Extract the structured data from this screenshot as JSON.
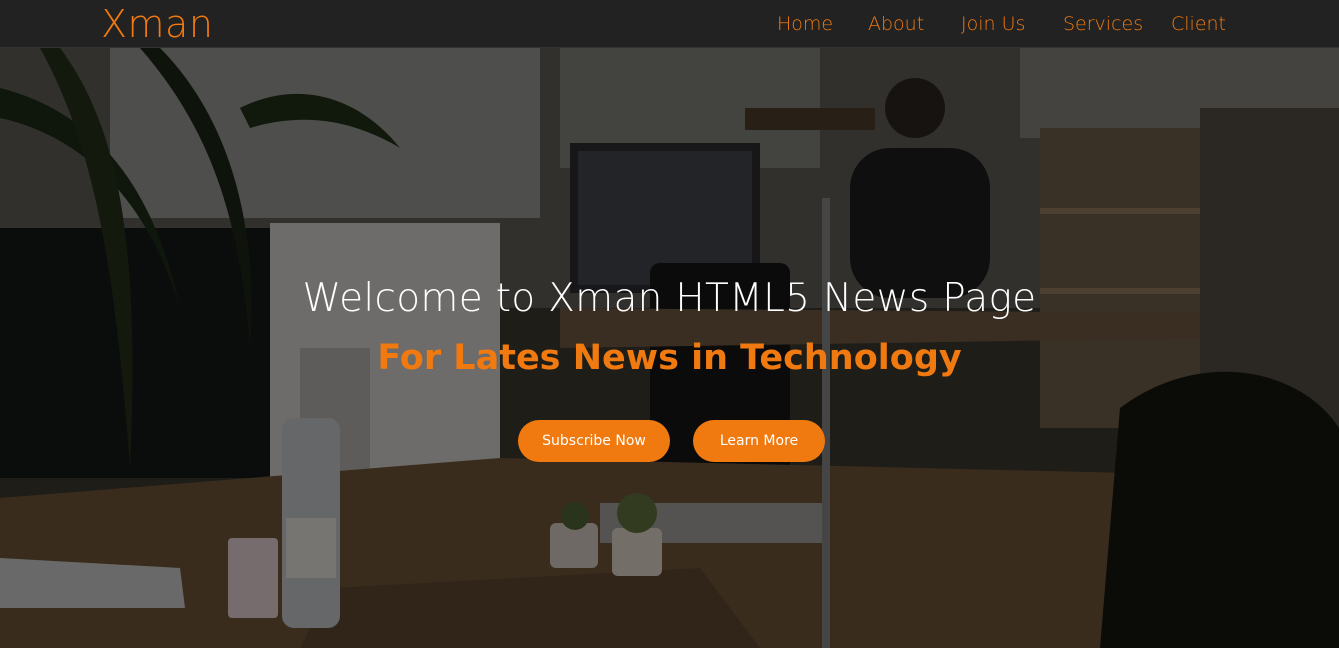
{
  "brand": "Xman",
  "nav": [
    {
      "label": "Home"
    },
    {
      "label": "About"
    },
    {
      "label": "Join Us"
    },
    {
      "label": "Services"
    },
    {
      "label": "Client"
    }
  ],
  "hero": {
    "title": "Welcome to Xman HTML5 News Page",
    "subtitle": "For Lates News in Technology",
    "buttons": {
      "subscribe": "Subscribe Now",
      "learn_more": "Learn More"
    }
  },
  "colors": {
    "accent": "#f07a10",
    "navbar_bg": "#222222",
    "title": "#ffffff",
    "button_text": "#ffffff"
  }
}
